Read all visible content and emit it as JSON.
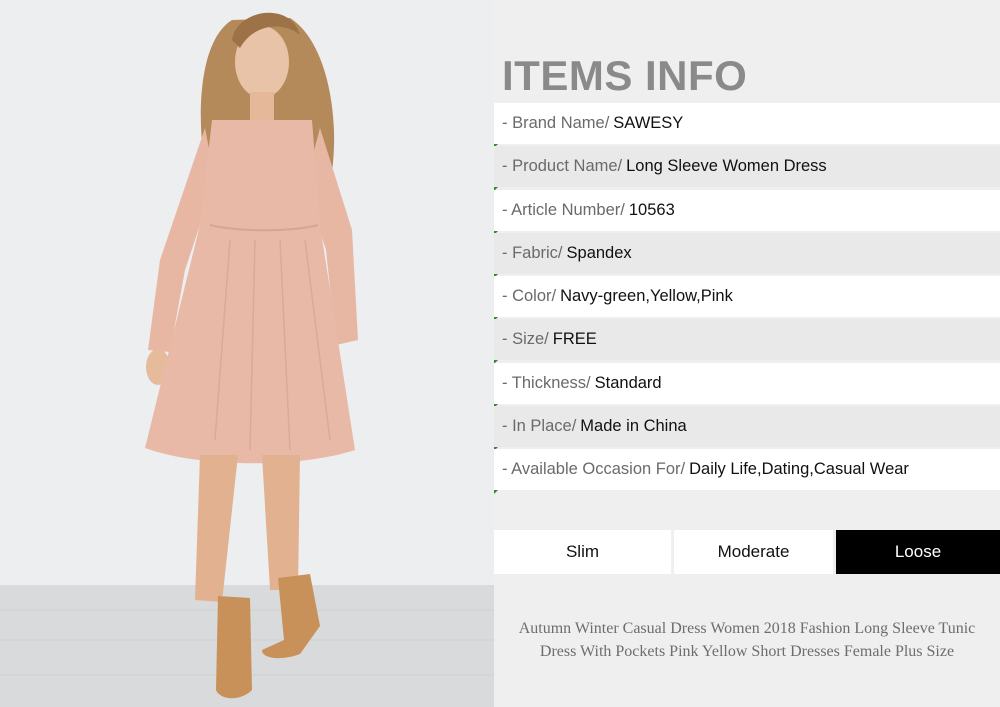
{
  "panel": {
    "title": "ITEMS INFO",
    "rows": [
      {
        "label": "- Brand Name/",
        "value": "SAWESY"
      },
      {
        "label": "- Product Name/",
        "value": "Long Sleeve Women Dress"
      },
      {
        "label": "- Article Number/",
        "value": "10563"
      },
      {
        "label": "- Fabric/",
        "value": "Spandex"
      },
      {
        "label": "- Color/",
        "value": "Navy-green,Yellow,Pink"
      },
      {
        "label": "- Size/",
        "value": "FREE"
      },
      {
        "label": "- Thickness/",
        "value": "Standard"
      },
      {
        "label": "- In Place/",
        "value": "Made in China"
      },
      {
        "label": "- Available Occasion For/",
        "value": "Daily Life,Dating,Casual Wear"
      }
    ],
    "fit": {
      "options": [
        "Slim",
        "Moderate",
        "Loose"
      ],
      "selected": "Loose"
    },
    "description_line1": "Autumn Winter Casual Dress Women 2018 Fashion Long Sleeve Tunic",
    "description_line2": "Dress With Pockets Pink Yellow Short Dresses Female Plus Size"
  },
  "colors": {
    "title": "#8a8a8a",
    "dress": "#e9b9a8",
    "fit_selected_bg": "#000000",
    "row_marker": "#2e8b2e"
  }
}
